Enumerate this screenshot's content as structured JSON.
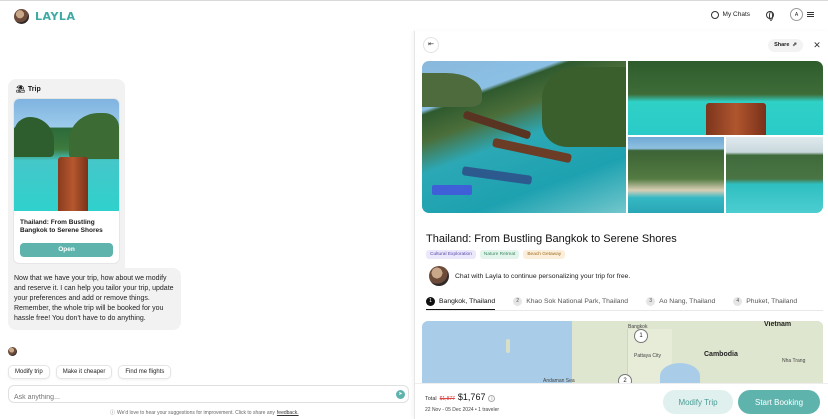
{
  "app": {
    "logo_text": "LAYLA"
  },
  "header": {
    "my_chats": "My Chats",
    "user_initial": "A"
  },
  "chat": {
    "trip_card": {
      "label": "Trip",
      "title": "Thailand: From Bustling Bangkok to Serene Shores",
      "open_label": "Open"
    },
    "message": "Now that we have your trip, how about we modify and reserve it. I can help you tailor your trip, update your preferences and add or remove things. Remember, the whole trip will be booked for you hassle free! You don't have to do anything.",
    "suggestions": [
      "Modify trip",
      "Make it cheaper",
      "Find me flights"
    ],
    "input_placeholder": "Ask anything...",
    "footnote_text": "We'd love to hear your suggestions for improvement. Click to share any",
    "footnote_link": "feedback."
  },
  "panel": {
    "share_label": "Share",
    "title": "Thailand: From Bustling Bangkok to Serene Shores",
    "tags": [
      "Cultural Exploration",
      "Nature Retreat",
      "Beach Getaway"
    ],
    "chat_prompt": "Chat with Layla to continue personalizing your trip for free.",
    "stops": [
      {
        "num": "1",
        "name": "Bangkok, Thailand"
      },
      {
        "num": "2",
        "name": "Khao Sok National Park, Thailand"
      },
      {
        "num": "3",
        "name": "Ao Nang, Thailand"
      },
      {
        "num": "4",
        "name": "Phuket, Thailand"
      }
    ],
    "map": {
      "labels": {
        "bangkok": "Bangkok",
        "vietnam": "Vietnam",
        "cambodia": "Cambodia",
        "pattaya": "Pattaya City",
        "andaman": "Andaman Sea",
        "nha_trang": "Nha Trang"
      },
      "pins": [
        "1",
        "2"
      ]
    },
    "booking": {
      "total_label": "Total",
      "old_price": "$1,877",
      "new_price": "$1,767",
      "dates": "22 Nov - 05 Dec 2024 • 1 traveler",
      "modify_label": "Modify Trip",
      "start_label": "Start Booking"
    }
  },
  "colors": {
    "accent": "#5fb3ad",
    "logo": "#3fa9a3"
  },
  "icons": [
    "chat-bubble-icon",
    "globe-icon",
    "user-icon",
    "menu-icon",
    "trip-icon",
    "send-icon",
    "info-icon",
    "collapse-panel-icon",
    "share-icon",
    "close-icon"
  ]
}
